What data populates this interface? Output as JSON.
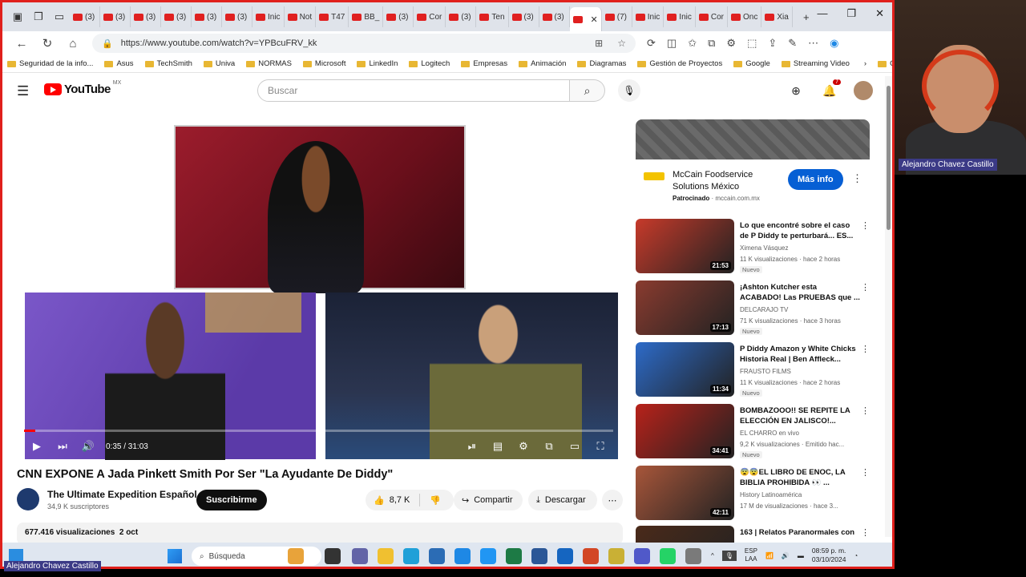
{
  "browser": {
    "tabs": [
      {
        "label": "(3)"
      },
      {
        "label": "(3)"
      },
      {
        "label": "(3)"
      },
      {
        "label": "(3)"
      },
      {
        "label": "(3)"
      },
      {
        "label": "(3)"
      },
      {
        "label": "Inic"
      },
      {
        "label": "Not"
      },
      {
        "label": "T47"
      },
      {
        "label": "BB_"
      },
      {
        "label": "(3)"
      },
      {
        "label": "Cor"
      },
      {
        "label": "(3)"
      },
      {
        "label": "Ten"
      },
      {
        "label": "(3)"
      },
      {
        "label": "(3)"
      },
      {
        "label": ""
      },
      {
        "label": "(7)"
      },
      {
        "label": "Inic"
      },
      {
        "label": "Inic"
      },
      {
        "label": "Cor"
      },
      {
        "label": "Onc"
      },
      {
        "label": "Xia"
      }
    ],
    "url": "https://www.youtube.com/watch?v=YPBcuFRV_kk",
    "bookmarks": [
      "Seguridad de la info...",
      "Asus",
      "TechSmith",
      "Univa",
      "NORMAS",
      "Microsoft",
      "LinkedIn",
      "Logitech",
      "Empresas",
      "Animación",
      "Diagramas",
      "Gestión de Proyectos",
      "Google",
      "Streaming Video"
    ],
    "other_bookmarks": "Otros favoritos"
  },
  "youtube": {
    "logo_text": "YouTube",
    "region": "MX",
    "search_placeholder": "Buscar",
    "notification_count": "7"
  },
  "player": {
    "time": "0:35 / 31:03",
    "progress_fraction": 0.019
  },
  "video": {
    "title": "CNN EXPONE A Jada Pinkett Smith Por Ser \"La Ayudante De Diddy\"",
    "channel": "The Ultimate Expedition Español",
    "subscribers": "34,9 K suscriptores",
    "subscribe_label": "Suscribirme",
    "likes": "8,7 K",
    "share_label": "Compartir",
    "download_label": "Descargar",
    "views": "677.416 visualizaciones",
    "date": "2 oct"
  },
  "ad": {
    "title": "McCain Foodservice Solutions México",
    "sponsored": "Patrocinado",
    "domain": "mccain.com.mx",
    "button": "Más info"
  },
  "recommendations": [
    {
      "title": "Lo que encontré sobre el caso de P Diddy te perturbará... ES...",
      "channel": "Ximena Vásquez",
      "meta": "11 K visualizaciones · hace 2 horas",
      "badge": "Nuevo",
      "duration": "21:53",
      "color": "#c73a2a"
    },
    {
      "title": "¡Ashton Kutcher esta ACABADO! Las PRUEBAS que ...",
      "channel": "DELCARAJO TV",
      "meta": "71 K visualizaciones · hace 3 horas",
      "badge": "Nuevo",
      "duration": "17:13",
      "color": "#8a3b2f"
    },
    {
      "title": "P Diddy Amazon y White Chicks Historia Real | Ben Affleck...",
      "channel": "FRAUSTO FILMS",
      "meta": "11 K visualizaciones · hace 2 horas",
      "badge": "Nuevo",
      "duration": "11:34",
      "color": "#2d6bc9"
    },
    {
      "title": "BOMBAZOOO!! SE REPITE LA ELECCIÓN EN JALISCO!...",
      "channel": "EL CHARRO en vivo",
      "meta": "9,2 K visualizaciones · Emitido hac...",
      "badge": "Nuevo",
      "duration": "34:41",
      "color": "#b8221a"
    },
    {
      "title": "😨😨EL LIBRO DE ENOC, LA BIBLIA PROHIBIDA 👀 ...",
      "channel": "History Latinoamérica",
      "meta": "17 M de visualizaciones · hace 3...",
      "badge": "",
      "duration": "42:11",
      "color": "#a8563a"
    },
    {
      "title": "163 | Relatos Paranormales con",
      "channel": "",
      "meta": "",
      "badge": "",
      "duration": "",
      "color": "#4a2a1a"
    }
  ],
  "taskbar": {
    "search": "Búsqueda",
    "lang_top": "ESP",
    "lang_bottom": "LAA",
    "time": "08:59 p. m.",
    "date": "03/10/2024"
  },
  "webcam": {
    "name_label": "Alejandro Chavez Castillo"
  },
  "bottom_label": "Alejandro Chavez Castillo"
}
